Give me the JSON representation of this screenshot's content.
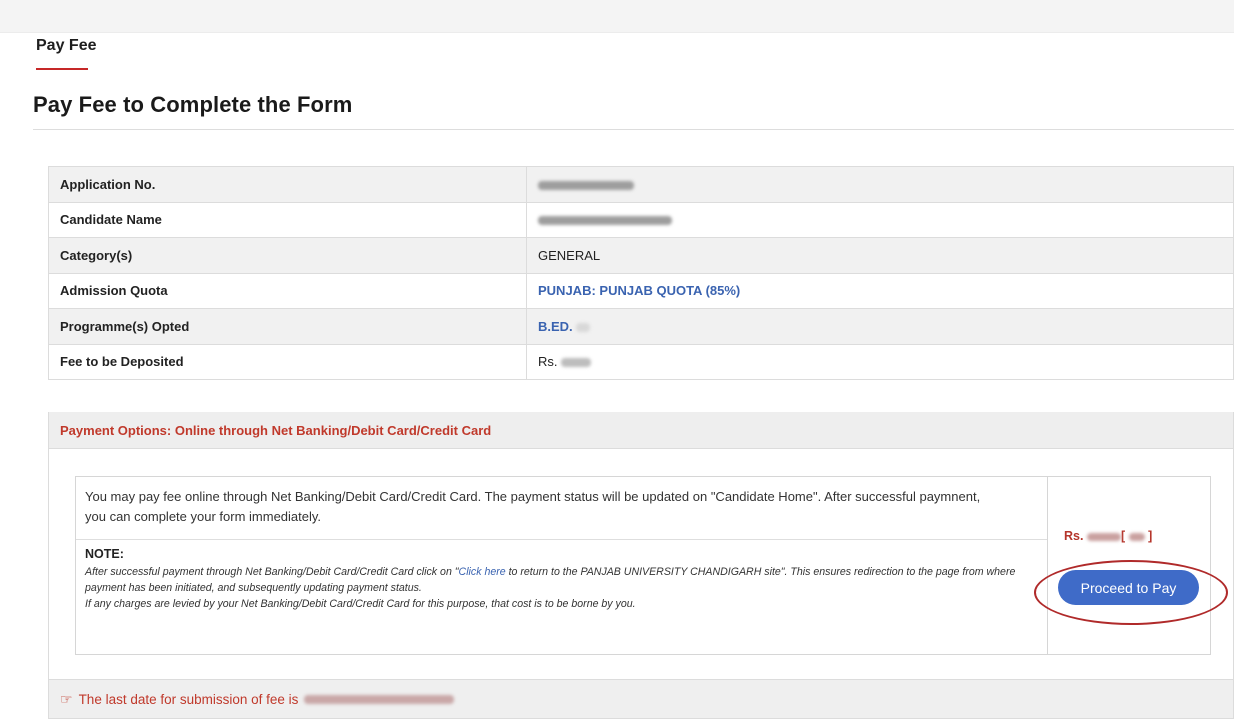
{
  "tab": {
    "label": "Pay Fee"
  },
  "page": {
    "title": "Pay Fee to Complete the Form"
  },
  "details": {
    "rows": [
      {
        "label": "Application No.",
        "value": ""
      },
      {
        "label": "Candidate Name",
        "value": ""
      },
      {
        "label": "Category(s)",
        "value": "GENERAL"
      },
      {
        "label": "Admission Quota",
        "value": "PUNJAB: PUNJAB QUOTA (85%)"
      },
      {
        "label": "Programme(s) Opted",
        "value": "B.ED."
      },
      {
        "label": "Fee to be Deposited",
        "value": "Rs."
      }
    ]
  },
  "payment": {
    "options_heading": "Payment Options: Online through Net Banking/Debit Card/Credit Card",
    "description": "You may pay fee online through Net Banking/Debit Card/Credit Card. The payment status will be updated on \"Candidate Home\". After successful paymnent, you can complete your form immediately.",
    "note_heading": "NOTE:",
    "note_line1_before": "After successful payment through Net Banking/Debit Card/Credit Card click on \"",
    "note_link": "Click here",
    "note_line1_after": " to return to the PANJAB UNIVERSITY CHANDIGARH site\". This ensures redirection to the page from where payment has been initiated, and subsequently updating payment status.",
    "note_line2": "If any charges are levied by your Net Banking/Debit Card/Credit Card for this purpose, that cost is to be borne by you.",
    "amount_prefix": "Rs.",
    "amount_bracket_open": "[",
    "amount_bracket_close": "]",
    "proceed_label": "Proceed to Pay",
    "deadline_icon": "pointing-hand-icon",
    "deadline_text": "The last date for submission of fee is"
  }
}
